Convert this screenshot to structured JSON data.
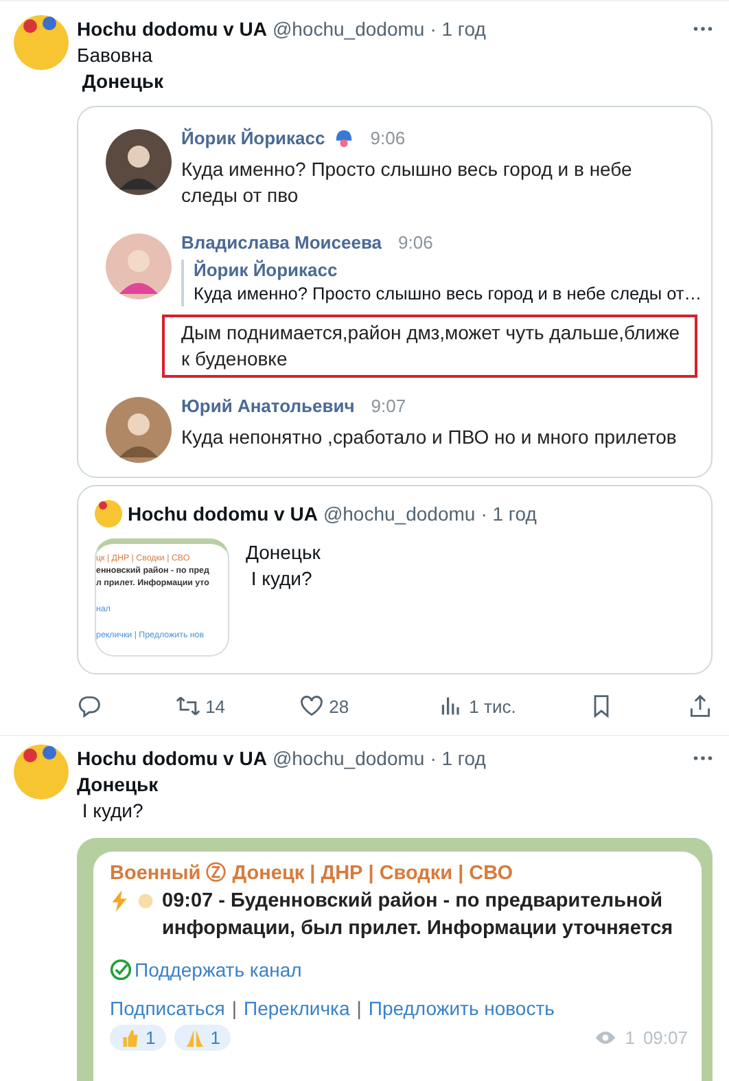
{
  "post": {
    "author": "Hochu dodomu v UA",
    "handle": "@hochu_dodomu",
    "time": "· 1 год",
    "lines": [
      {
        "text": "Бавовна",
        "bold": false
      },
      {
        "text": " Донецьк",
        "bold": true
      }
    ],
    "comments": [
      {
        "name": "Йорик Йорикасс",
        "badge": true,
        "time": "9:06",
        "text": "Куда именно? Просто слышно весь город и в небе следы от пво",
        "highlighted": false
      },
      {
        "name": "Владислава Моисеева",
        "badge": false,
        "time": "9:06",
        "reply_to": {
          "name": "Йорик Йорикасс",
          "text": "Куда именно? Просто слышно весь город и в небе следы от…"
        },
        "text": "Дым поднимается,район дмз,может чуть дальше,ближе к буденовке",
        "highlighted": true
      },
      {
        "name": "Юрий Анатольевич",
        "badge": false,
        "time": "9:07",
        "text": "Куда непонятно ,сработало и ПВО но и много прилетов",
        "highlighted": false
      }
    ],
    "quote": {
      "author": "Hochu dodomu v UA",
      "handle": "@hochu_dodomu",
      "time": "· 1 год",
      "thumbnail_lines": [
        {
          "text": "цк | ДНР | Сводки | СВО",
          "kind": "title"
        },
        {
          "text": "енновский район - по пред",
          "kind": "bold"
        },
        {
          "text": "л прилет. Информации уто",
          "kind": "bold"
        },
        {
          "text": "нал",
          "kind": "link"
        },
        {
          "text": "реклички | Предложить нов",
          "kind": "link"
        }
      ],
      "lines": [
        "Донецьк",
        " І куди?"
      ]
    },
    "actions": [
      {
        "kind": "reply"
      },
      {
        "kind": "repost",
        "count": "14"
      },
      {
        "kind": "like",
        "count": "28"
      },
      {
        "kind": "views",
        "count": "1 тис."
      },
      {
        "kind": "bookmark"
      },
      {
        "kind": "share"
      }
    ]
  },
  "post_2": {
    "author": "Hochu dodomu v UA",
    "handle": "@hochu_dodomu",
    "time": "· 1 год",
    "lines": [
      {
        "text": "Донецьк",
        "bold": true
      },
      {
        "text": " І куди?",
        "bold": false
      }
    ],
    "telegram": {
      "channel": "Военный Ⓩ Донецк | ДНР | Сводки | СВО",
      "message": "09:07 - Буденновский район - по предварительной информации, был прилет. Информации уточняется",
      "support_link": "Поддержать канал",
      "links": [
        {
          "kind": "link",
          "text": "Подписаться"
        },
        {
          "kind": "separator",
          "text": "|"
        },
        {
          "kind": "link",
          "text": "Перекличка"
        },
        {
          "kind": "separator",
          "text": "|"
        },
        {
          "kind": "link",
          "text": "Предложить новость"
        }
      ],
      "reactions": [
        {
          "kind": "thumbs-up",
          "count": "1"
        },
        {
          "kind": "pray",
          "count": "1"
        }
      ],
      "views": "1",
      "time": "09:07"
    }
  }
}
